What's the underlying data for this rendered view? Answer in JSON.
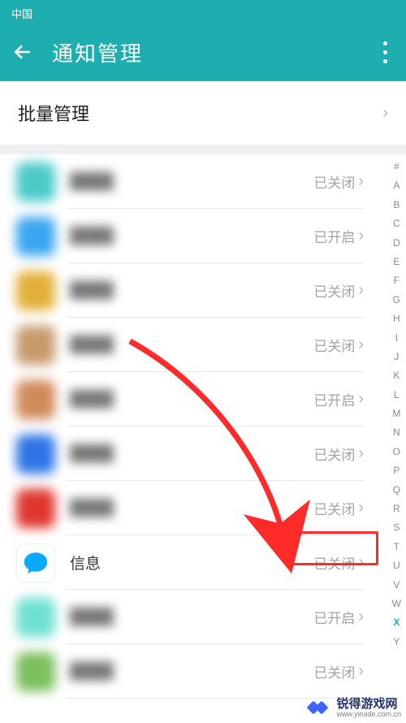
{
  "statusbar": {
    "carrier": "中国"
  },
  "appbar": {
    "title": "通知管理"
  },
  "batch": {
    "label": "批量管理"
  },
  "states": {
    "off": "已关闭",
    "on": "已开启"
  },
  "apps": [
    {
      "name": "—",
      "state_key": "off",
      "icon_color": "#4cc9c9",
      "blur": true
    },
    {
      "name": "—",
      "state_key": "on",
      "icon_color": "#3aa6f0",
      "blur": true
    },
    {
      "name": "—",
      "state_key": "off",
      "icon_color": "#e2b03a",
      "blur": true
    },
    {
      "name": "—",
      "state_key": "off",
      "icon_color": "#c79a6b",
      "blur": true
    },
    {
      "name": "—",
      "state_key": "on",
      "icon_color": "#d08a5a",
      "blur": true
    },
    {
      "name": "—",
      "state_key": "off",
      "icon_color": "#2e74e6",
      "blur": true
    },
    {
      "name": "—",
      "state_key": "off",
      "icon_color": "#e0362e",
      "blur": true
    },
    {
      "name": "信息",
      "state_key": "off",
      "icon_color": "#09a9ff",
      "blur": false,
      "clear": true,
      "highlighted": true
    },
    {
      "name": "—",
      "state_key": "on",
      "icon_color": "#6fe0d2",
      "blur": true
    },
    {
      "name": "—",
      "state_key": "off",
      "icon_color": "#7bbf5f",
      "blur": true
    }
  ],
  "index_bar": [
    "#",
    "A",
    "B",
    "C",
    "D",
    "E",
    "F",
    "G",
    "H",
    "I",
    "J",
    "K",
    "L",
    "M",
    "N",
    "O",
    "P",
    "Q",
    "R",
    "S",
    "T",
    "U",
    "V",
    "W",
    "X",
    "Y"
  ],
  "index_active": "X",
  "watermark": {
    "cn": "锐得游戏网",
    "en": "www.yiruide.com.cn"
  }
}
